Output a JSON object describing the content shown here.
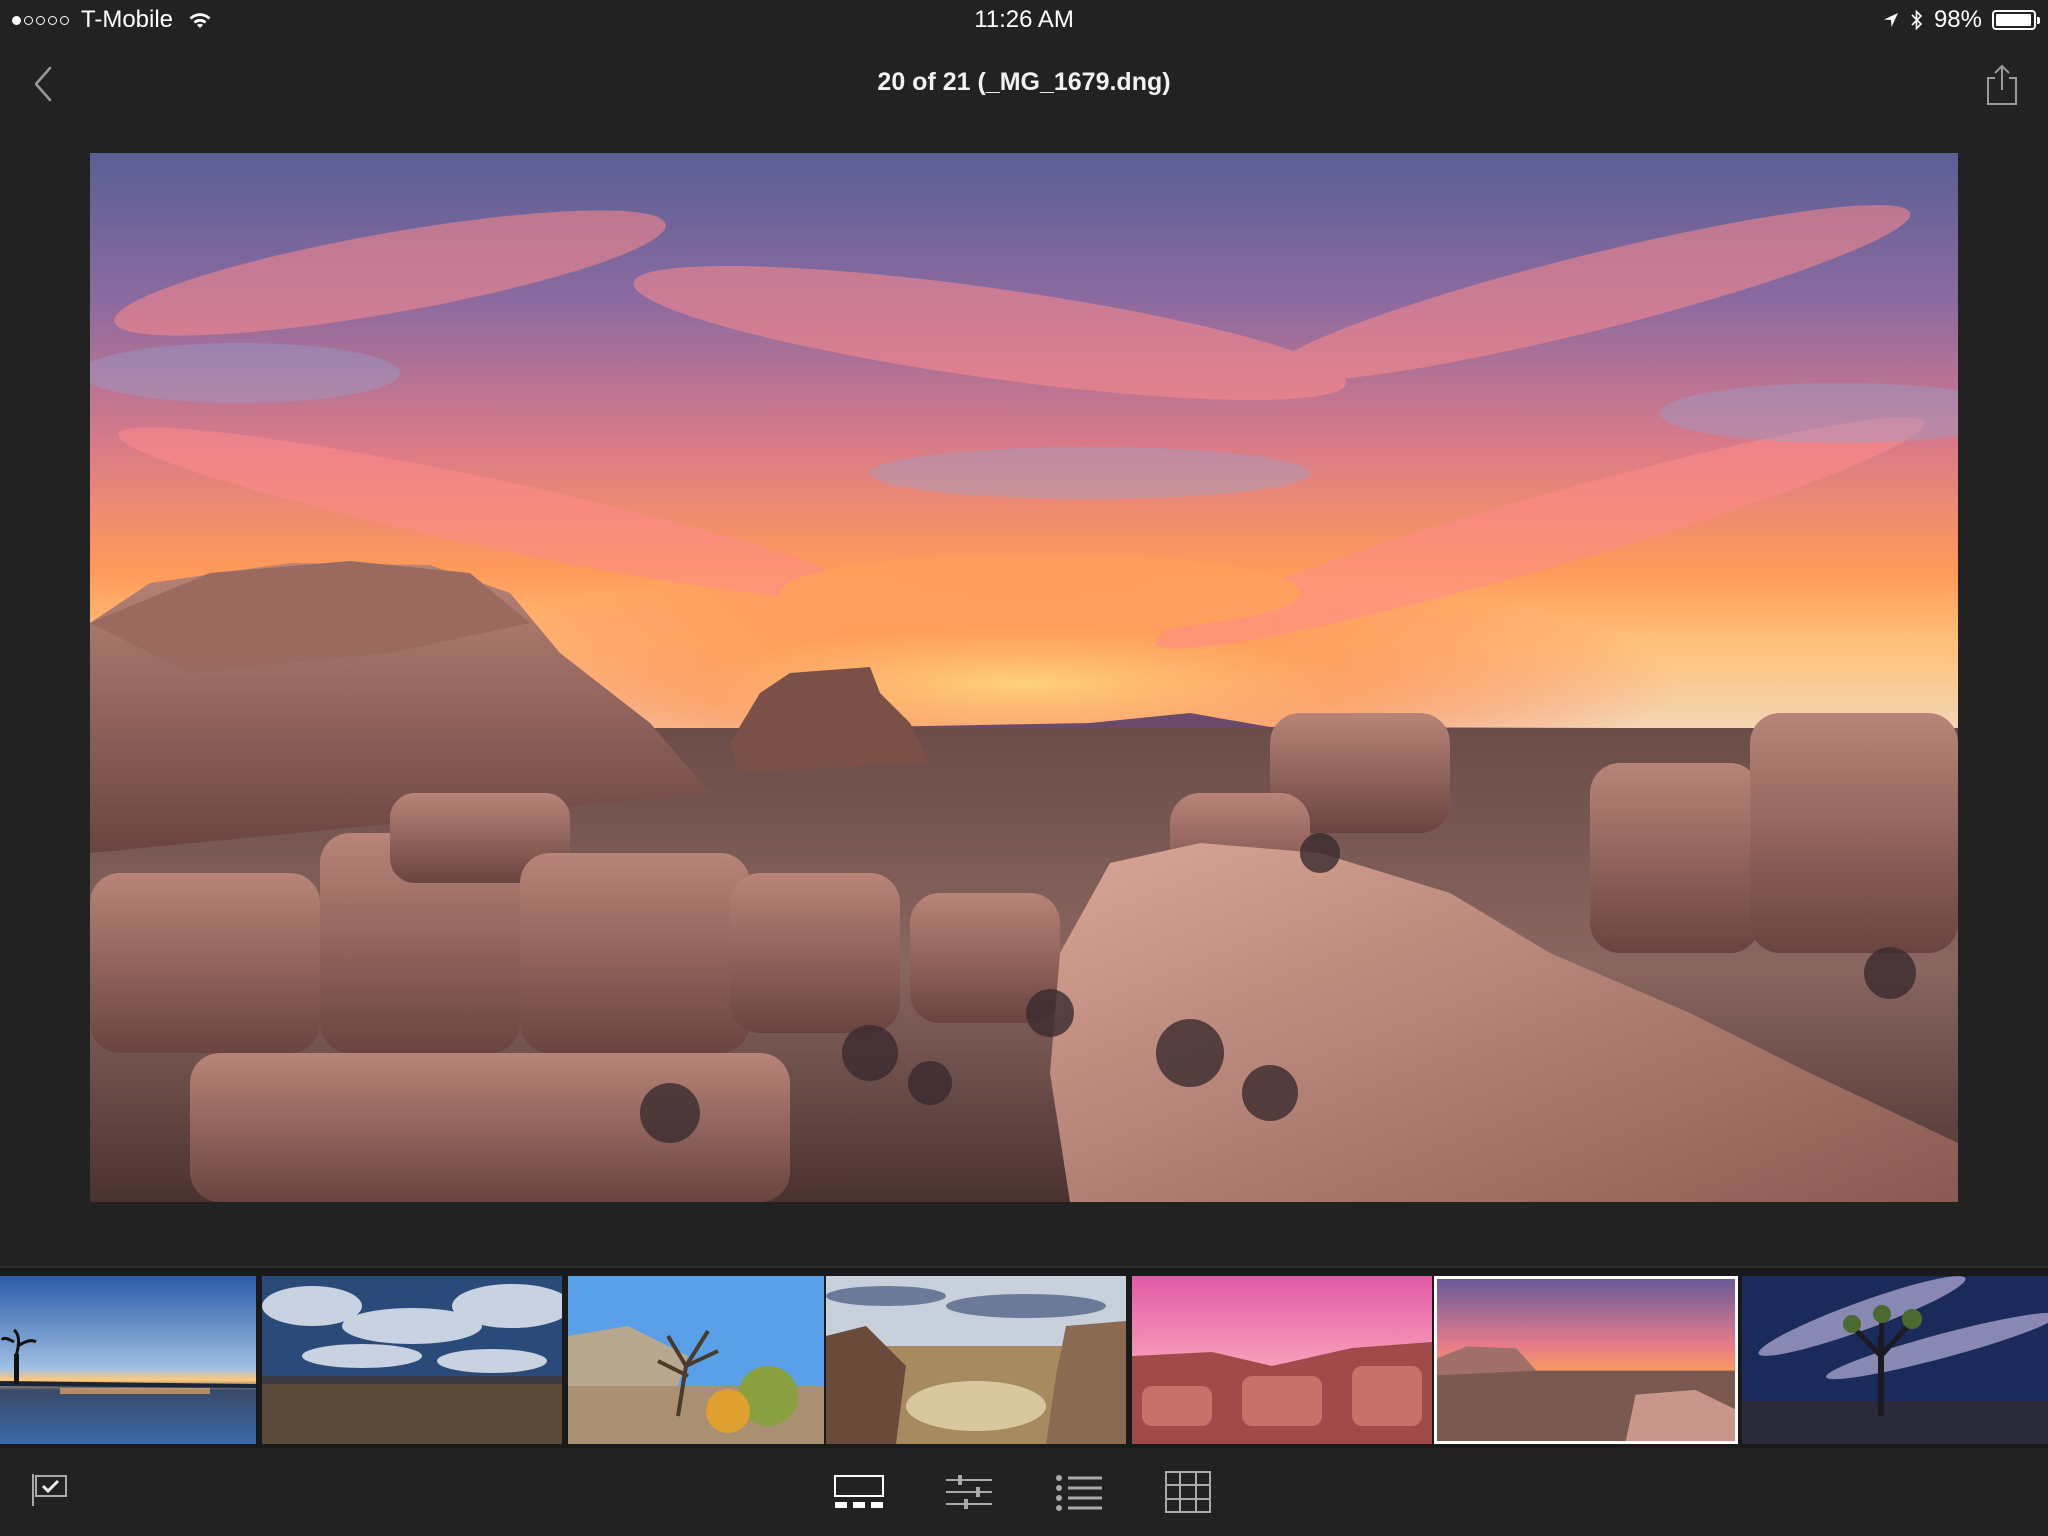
{
  "status_bar": {
    "carrier": "T-Mobile",
    "signal_strength": 1,
    "time": "11:26 AM",
    "battery_percent": "98%",
    "battery_level": 0.98,
    "icons": [
      "wifi-icon",
      "location-arrow-icon",
      "bluetooth-icon",
      "battery-icon"
    ]
  },
  "nav": {
    "title": "20 of 21 (_MG_1679.dng)",
    "back_icon": "chevron-left-icon",
    "share_icon": "share-icon"
  },
  "filmstrip": {
    "selected_index": 5,
    "thumbnails": [
      {
        "scene": "lake-sunset-tree"
      },
      {
        "scene": "cloudy-plains"
      },
      {
        "scene": "joshua-tree-blue-sky"
      },
      {
        "scene": "boulder-canyon"
      },
      {
        "scene": "pink-sky-rocks"
      },
      {
        "scene": "desert-sunset-rocks"
      },
      {
        "scene": "night-joshua-tree"
      }
    ]
  },
  "toolbar": {
    "items": [
      {
        "name": "flag-icon"
      },
      {
        "name": "filmstrip-view-icon"
      },
      {
        "name": "adjust-sliders-icon"
      },
      {
        "name": "info-list-icon"
      },
      {
        "name": "grid-view-icon"
      }
    ]
  },
  "colors": {
    "background": "#222222",
    "filmstrip_bg": "#1a1a1a",
    "selected_border": "#ffffff"
  }
}
